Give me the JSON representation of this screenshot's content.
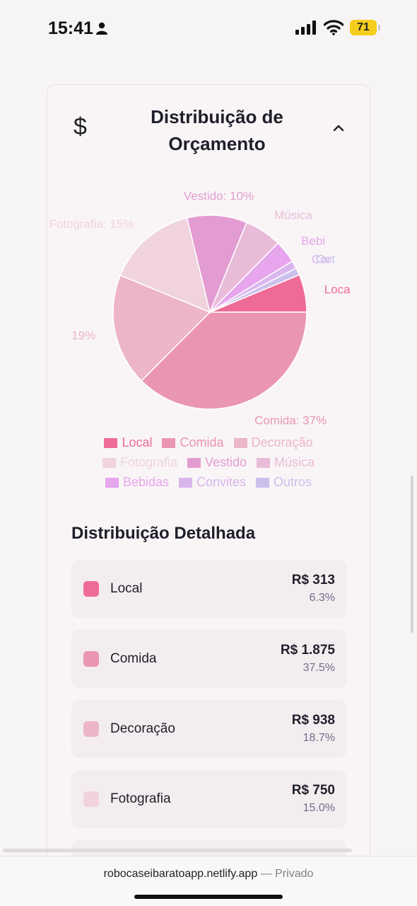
{
  "status_bar": {
    "time": "15:41",
    "battery": "71",
    "icons": [
      "person-icon",
      "signal-icon",
      "wifi-icon",
      "battery-icon"
    ]
  },
  "card": {
    "title": "Distribuição de Orçamento",
    "icon": "dollar-icon",
    "collapse_icon": "chevron-up-icon"
  },
  "chart_data": {
    "type": "pie",
    "title": "",
    "slices": [
      {
        "name": "Local",
        "value": 6.3,
        "color": "#ef6b97",
        "label": "Loca"
      },
      {
        "name": "Comida",
        "value": 37.5,
        "color": "#ea96b2",
        "label": "Comida: 37%"
      },
      {
        "name": "Decoração",
        "value": 18.7,
        "color": "#ecb5c8",
        "label": "19%"
      },
      {
        "name": "Fotografia",
        "value": 15.0,
        "color": "#f0d3dd",
        "label": "Fotografia: 15%"
      },
      {
        "name": "Vestido",
        "value": 10.0,
        "color": "#e39cd2",
        "label": "Vestido: 10%"
      },
      {
        "name": "Música",
        "value": 6.2,
        "color": "#e8bcd9",
        "label": "Música"
      },
      {
        "name": "Bebidas",
        "value": 3.8,
        "color": "#e6a5ec",
        "label": "Bebi"
      },
      {
        "name": "Convites",
        "value": 1.3,
        "color": "#d9b5ed",
        "label": "Cor"
      },
      {
        "name": "Outros",
        "value": 1.2,
        "color": "#cbc0ec",
        "label": "Out"
      }
    ],
    "legend": [
      "Local",
      "Comida",
      "Decoração",
      "Fotografia",
      "Vestido",
      "Música",
      "Bebidas",
      "Convites",
      "Outros"
    ],
    "legend_position": "bottom"
  },
  "details": {
    "title": "Distribuição Detalhada",
    "rows": [
      {
        "name": "Local",
        "amount": "R$ 313",
        "percent": "6.3%",
        "color": "#ef6b97"
      },
      {
        "name": "Comida",
        "amount": "R$ 1.875",
        "percent": "37.5%",
        "color": "#ea96b2"
      },
      {
        "name": "Decoração",
        "amount": "R$ 938",
        "percent": "18.7%",
        "color": "#ecb5c8"
      },
      {
        "name": "Fotografia",
        "amount": "R$ 750",
        "percent": "15.0%",
        "color": "#f0d3dd"
      }
    ]
  },
  "browser": {
    "url": "robocaseibaratoapp.netlify.app",
    "mode": "— Privado"
  }
}
